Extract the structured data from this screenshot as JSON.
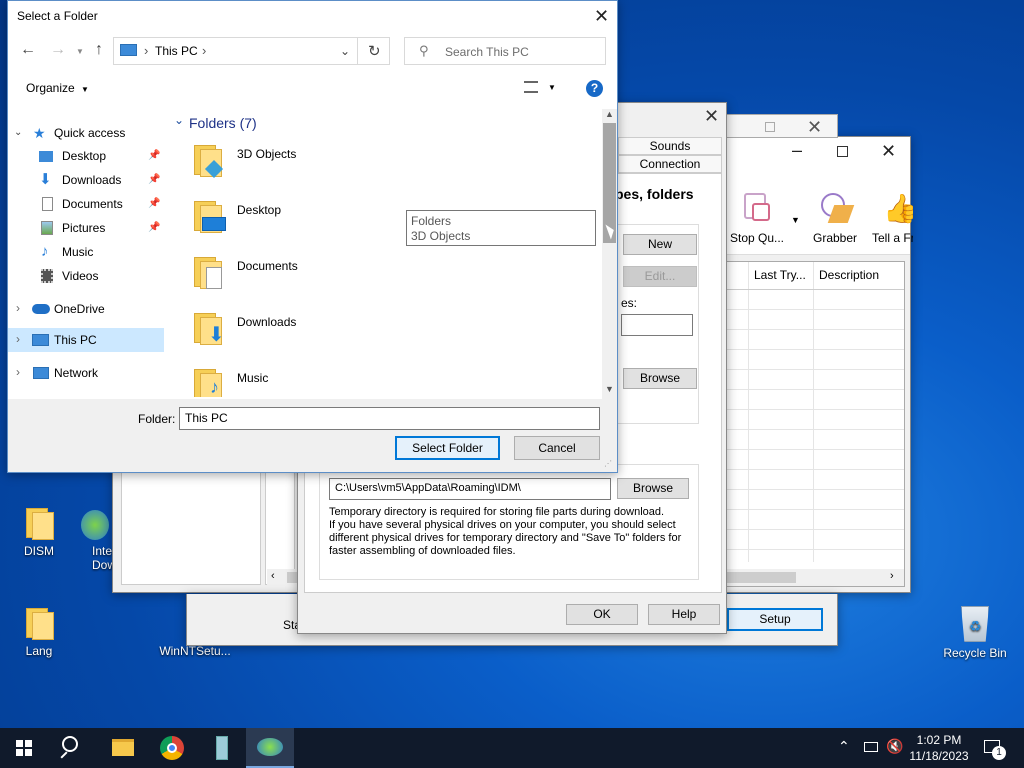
{
  "desktop": {
    "icons": [
      {
        "label": "DISM"
      },
      {
        "label": "Inte Dow"
      },
      {
        "label": "Lang"
      },
      {
        "label": "WinNTSetu..."
      },
      {
        "label": "Recycle Bin"
      }
    ]
  },
  "idm_main": {
    "toolbar": [
      {
        "label": "Stop Qu..."
      },
      {
        "label": "Grabber"
      },
      {
        "label": "Tell a Fri"
      }
    ],
    "columns": [
      "Last Try...",
      "Description"
    ]
  },
  "idm_options": {
    "tabs": [
      "Sounds",
      "Connection"
    ],
    "section_title": "pes, folders",
    "buttons": {
      "new": "New",
      "edit": "Edit...",
      "browse1": "Browse",
      "browse2": "Browse",
      "ok": "OK",
      "help": "Help",
      "setup": "Setup"
    },
    "label_es": "es:",
    "temp_path": "C:\\Users\\vm5\\AppData\\Roaming\\IDM\\",
    "temp_note": [
      "Temporary directory is required for storing file parts during download.",
      "If you have several physical drives on your computer, you should select",
      "different physical drives for temporary directory and \"Save To\" folders for",
      "faster assembling of downloaded files."
    ],
    "sta": "Sta"
  },
  "dialog": {
    "title": "Select a Folder",
    "breadcrumb": [
      "This PC"
    ],
    "search_placeholder": "Search This PC",
    "organize": "Organize",
    "nav": {
      "quick_access": "Quick access",
      "quick_items": [
        "Desktop",
        "Downloads",
        "Documents",
        "Pictures",
        "Music",
        "Videos"
      ],
      "onedrive": "OneDrive",
      "this_pc": "This PC",
      "network": "Network"
    },
    "group_header": "Folders (7)",
    "folders": [
      "3D Objects",
      "Desktop",
      "Documents",
      "Downloads",
      "Music"
    ],
    "tooltip": [
      "Folders",
      "3D Objects"
    ],
    "folder_label": "Folder:",
    "folder_value": "This PC",
    "select_button": "Select Folder",
    "cancel_button": "Cancel"
  },
  "taskbar": {
    "time": "1:02 PM",
    "date": "11/18/2023",
    "notification_count": "1"
  }
}
